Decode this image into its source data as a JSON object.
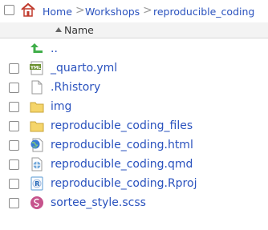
{
  "breadcrumb": {
    "items": [
      "Home",
      "Workshops",
      "reproducible_coding"
    ],
    "separator": ">"
  },
  "header": {
    "name_label": "Name"
  },
  "files": [
    {
      "name": "..",
      "icon": "go-up-icon"
    },
    {
      "name": "_quarto.yml",
      "icon": "yml-file-icon"
    },
    {
      "name": ".Rhistory",
      "icon": "text-file-icon"
    },
    {
      "name": "img",
      "icon": "folder-icon"
    },
    {
      "name": "reproducible_coding_files",
      "icon": "folder-icon"
    },
    {
      "name": "reproducible_coding.html",
      "icon": "html-file-icon"
    },
    {
      "name": "reproducible_coding.qmd",
      "icon": "qmd-file-icon"
    },
    {
      "name": "reproducible_coding.Rproj",
      "icon": "rproj-file-icon"
    },
    {
      "name": "sortee_style.scss",
      "icon": "scss-file-icon"
    }
  ],
  "colors": {
    "link": "#2a52be",
    "folder": "#f5d56b",
    "up_arrow": "#3fae49",
    "scss": "#c6538c"
  }
}
